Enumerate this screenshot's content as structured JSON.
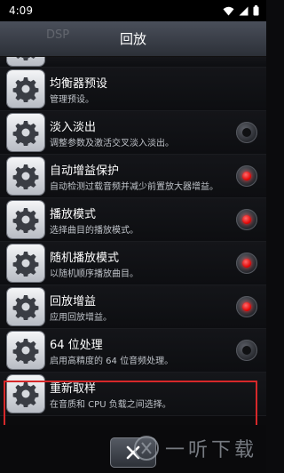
{
  "status_bar": {
    "time": "4:09",
    "icons": [
      "wifi-icon",
      "signal-icon",
      "battery-icon"
    ]
  },
  "title_bar": {
    "title": "回放",
    "faded_text": "DSP"
  },
  "rows": [
    {
      "title": "均衡器预设",
      "subtitle": "管理预设。",
      "has_radio": false,
      "checked": false
    },
    {
      "title": "淡入淡出",
      "subtitle": "调整参数及激活交叉淡入淡出。",
      "has_radio": true,
      "checked": false
    },
    {
      "title": "自动增益保护",
      "subtitle": "自动检测过载音频并减少前置放大器增益。",
      "has_radio": true,
      "checked": true
    },
    {
      "title": "播放模式",
      "subtitle": "选择曲目的播放模式。",
      "has_radio": true,
      "checked": true
    },
    {
      "title": "随机播放模式",
      "subtitle": "以随机顺序播放曲目。",
      "has_radio": true,
      "checked": true
    },
    {
      "title": "回放增益",
      "subtitle": "应用回放增益。",
      "has_radio": true,
      "checked": true
    },
    {
      "title": "64 位处理",
      "subtitle": "启用高精度的 64 位音频处理。",
      "has_radio": true,
      "checked": false
    },
    {
      "title": "重新取样",
      "subtitle": "在音质和 CPU 负载之间选择。",
      "has_radio": false,
      "checked": false
    }
  ],
  "watermark": {
    "text": "一听下载"
  },
  "colors": {
    "accent_red": "#e00000",
    "highlight_border": "#d6282a"
  }
}
